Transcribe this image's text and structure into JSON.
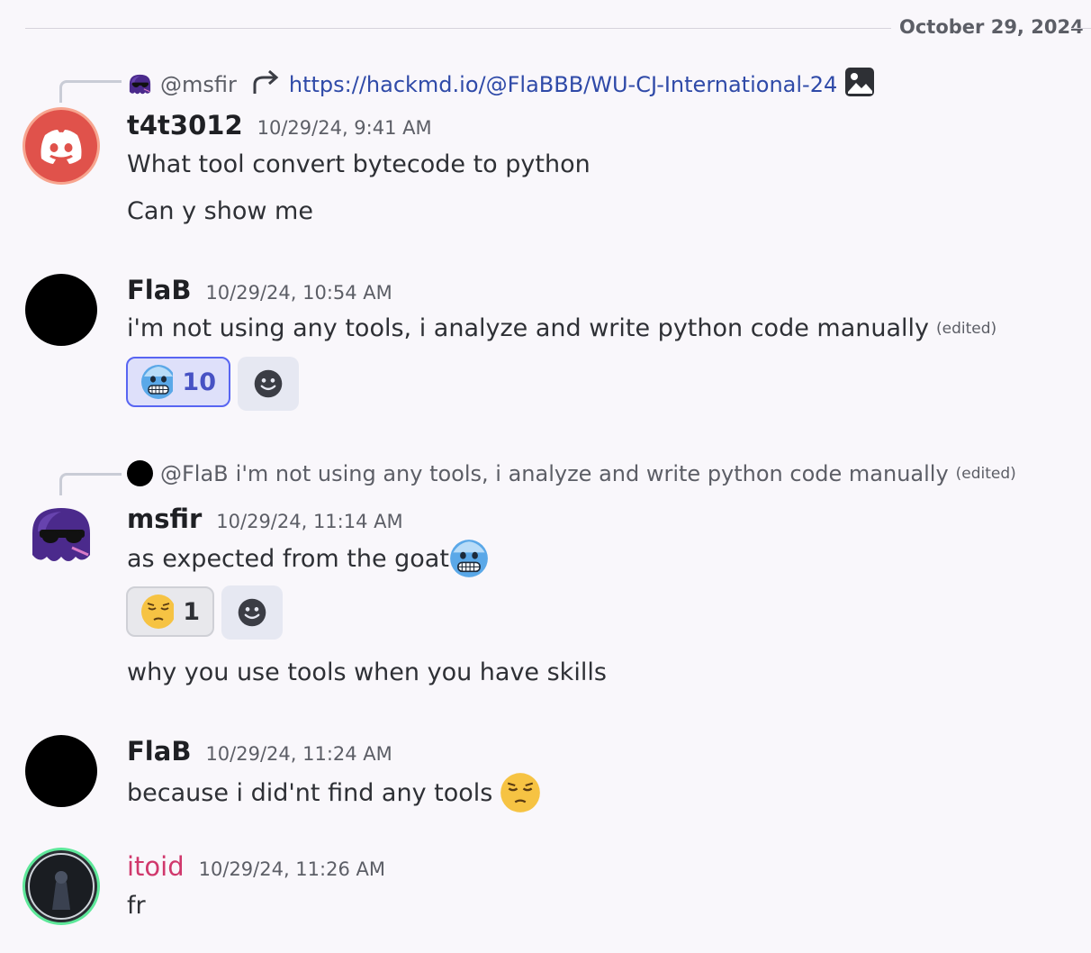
{
  "divider": {
    "date": "October 29, 2024"
  },
  "messages": [
    {
      "reply": {
        "username": "@msfir",
        "link": "https://hackmd.io/@FlaBBB/WU-CJ-International-24"
      },
      "author": "t4t3012",
      "timestamp": "10/29/24, 9:41 AM",
      "lines": [
        "What tool convert bytecode to python",
        "Can y show me"
      ]
    },
    {
      "author": "FlaB",
      "timestamp": "10/29/24, 10:54 AM",
      "lines": [
        "i'm not using any tools, i analyze and write python code manually"
      ],
      "edited": "(edited)",
      "reactions": [
        {
          "emoji": "cold-face",
          "count": "10",
          "active": true
        }
      ]
    },
    {
      "reply": {
        "username": "@FlaB",
        "text": "i'm not using any tools, i analyze and write python code manually",
        "edited": "(edited)"
      },
      "author": "msfir",
      "timestamp": "10/29/24, 11:14 AM",
      "lines": [
        "as expected from the goat",
        "why you use tools when you have skills"
      ],
      "reactions": [
        {
          "emoji": "pensive-face",
          "count": "1",
          "active": false
        }
      ]
    },
    {
      "author": "FlaB",
      "timestamp": "10/29/24, 11:24 AM",
      "lines": [
        "because i did'nt find any tools"
      ]
    },
    {
      "author": "itoid",
      "timestamp": "10/29/24, 11:26 AM",
      "lines": [
        "fr"
      ]
    }
  ],
  "colors": {
    "mention_link": "#2f4aa8",
    "reaction_active_border": "#5865f2",
    "itoid_name": "#d0386c",
    "discord_red": "#e0524b"
  }
}
